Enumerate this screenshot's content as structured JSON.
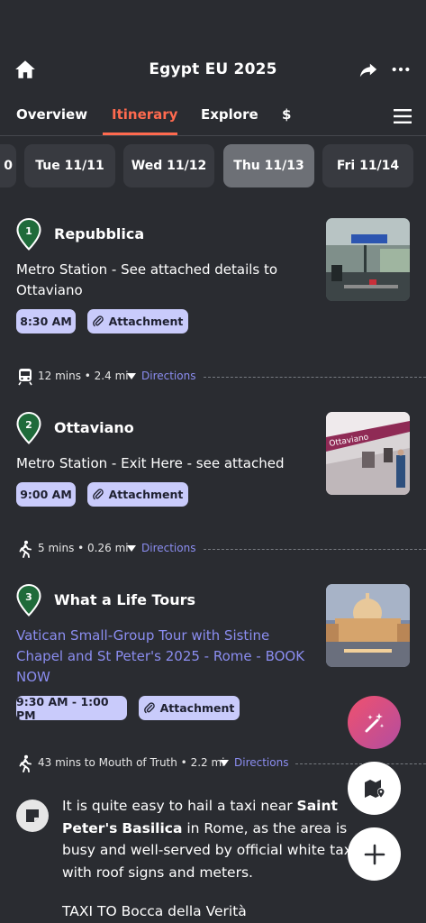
{
  "header": {
    "title": "Egypt EU 2025",
    "home_icon": "home-icon",
    "share_icon": "share-icon",
    "more_icon": "more-icon"
  },
  "tabs": [
    {
      "label": "Overview",
      "active": false
    },
    {
      "label": "Itinerary",
      "active": true
    },
    {
      "label": "Explore",
      "active": false
    },
    {
      "label": "$",
      "active": false
    }
  ],
  "days": [
    {
      "label": "0",
      "selected": false
    },
    {
      "label": "Tue 11/11",
      "selected": false
    },
    {
      "label": "Wed 11/12",
      "selected": false
    },
    {
      "label": "Thu 11/13",
      "selected": true
    },
    {
      "label": "Fri 11/14",
      "selected": false
    }
  ],
  "stops": [
    {
      "number": "1",
      "name": "Repubblica",
      "description": "Metro Station - See attached details to Ottaviano",
      "time": "8:30 AM",
      "attachment_label": "Attachment",
      "pin_color": "#1f6b3a"
    },
    {
      "number": "2",
      "name": "Ottaviano",
      "description": "Metro Station - Exit Here - see attached",
      "time": "9:00 AM",
      "attachment_label": "Attachment",
      "pin_color": "#1f6b3a"
    },
    {
      "number": "3",
      "name": "What a Life Tours",
      "description": "Vatican Small-Group Tour with Sistine Chapel and St Peter's 2025 - Rome - BOOK NOW",
      "time": "9:30 AM - 1:00 PM",
      "attachment_label": "Attachment",
      "pin_color": "#1f6b3a"
    }
  ],
  "transits": [
    {
      "mode_icon": "train-icon",
      "text": "12 mins • 2.4 mi",
      "directions": "Directions"
    },
    {
      "mode_icon": "walk-icon",
      "text": "5 mins • 0.26 mi",
      "directions": "Directions"
    },
    {
      "mode_icon": "walk-icon",
      "text": "43 mins to Mouth of Truth • 2.2 mi",
      "directions": "Directions"
    }
  ],
  "note": {
    "text_pre": "It is quite easy to hail a taxi near ",
    "bold1": "Saint Peter's",
    "text_mid1": " ",
    "bold2": "Basilica",
    "text_post": " in Rome, as the area is busy and well-served by official white taxis with roof signs and meters.",
    "heading": "TAXI TO Bocca della Verità"
  },
  "colors": {
    "accent": "#ff6a4f",
    "link": "#8b8df0",
    "chip_bg": "#c9cbfb",
    "background": "#2a2c31"
  }
}
